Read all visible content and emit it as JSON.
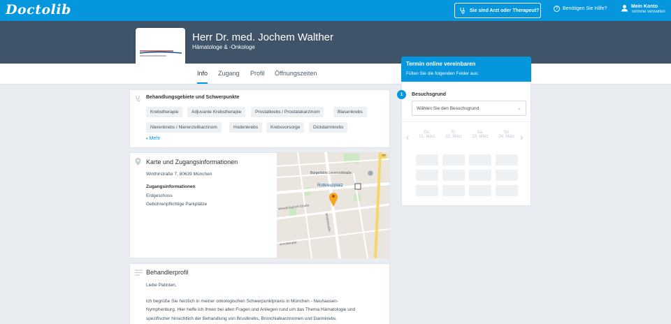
{
  "topbar": {
    "logo": "Doctolib",
    "doctor_button": "Sie sind Arzt oder Therapeut?",
    "help": "Benötigen Sie Hilfe?",
    "account_title": "Mein Konto",
    "account_sub": "Termine verwalten"
  },
  "doctor": {
    "name": "Herr Dr. med. Jochem Walther",
    "specialty": "Hämatologe & -Onkologe"
  },
  "tabs": [
    {
      "label": "Info"
    },
    {
      "label": "Zugang"
    },
    {
      "label": "Profil"
    },
    {
      "label": "Öffnungszeiten"
    }
  ],
  "specialties": {
    "title": "Behandlungsgebiete und Schwerpunkte",
    "chips": [
      "Krebstherapie",
      "Adjuvante Krebstherapie",
      "Prostatkrebs / Prostatakarzinom",
      "Blasenkrebs",
      "Nierenkrebs / Nierenzellkarzinom",
      "Hodenkrebs",
      "Krebsvorsorge",
      "Dickdarmkrebs"
    ],
    "more": "Mehr"
  },
  "access": {
    "title": "Karte und Zugangsinformationen",
    "address": "Winthirstraße 7, 80639 München",
    "info_title": "Zugangsinformationen",
    "line1": "Erdgeschoss",
    "line2": "Gebührenpflichtige Parkplätze"
  },
  "map": {
    "label_buergerbuero": "Bürgerbüro Leonrodstraße",
    "label_rotkreuz": "Rotkreuzplatz",
    "label_wendl": "Wendl-Dietrich-Straße",
    "label_arnulf": "Arnulfstraße",
    "label_winthir": "Winthirstraße",
    "badge": "2R"
  },
  "profile": {
    "title": "Behandlerprofil",
    "greeting": "Liebe Patinten,",
    "line1": "ich begrüße Sie herzlich in meiner onkologischen Schwerpunktpraxis in München - Neuhausen-",
    "line2": "Nymphenburg. Hier helfe ich Ihnen bei allen Fragen und Anliegen rund um das Thema Hämatologie und",
    "line3": "spezifischer hinsichtlich der Behandlung von Brustkrebs, Bronchialkarzinomen und Darmkrebs."
  },
  "booking": {
    "title": "Termin online vereinbaren",
    "subtitle": "Füllen Sie die folgenden Felder aus:",
    "step": "1",
    "field_label": "Besuchsgrund",
    "select_placeholder": "Wählen Sie den Besuchsgrund",
    "days": [
      {
        "name": "Do.",
        "date": "21. März"
      },
      {
        "name": "Fr.",
        "date": "22. März"
      },
      {
        "name": "Sa.",
        "date": "23. März"
      },
      {
        "name": "So.",
        "date": "24. März"
      }
    ]
  },
  "colors": {
    "brand": "#0596de",
    "header": "#3f5468"
  }
}
